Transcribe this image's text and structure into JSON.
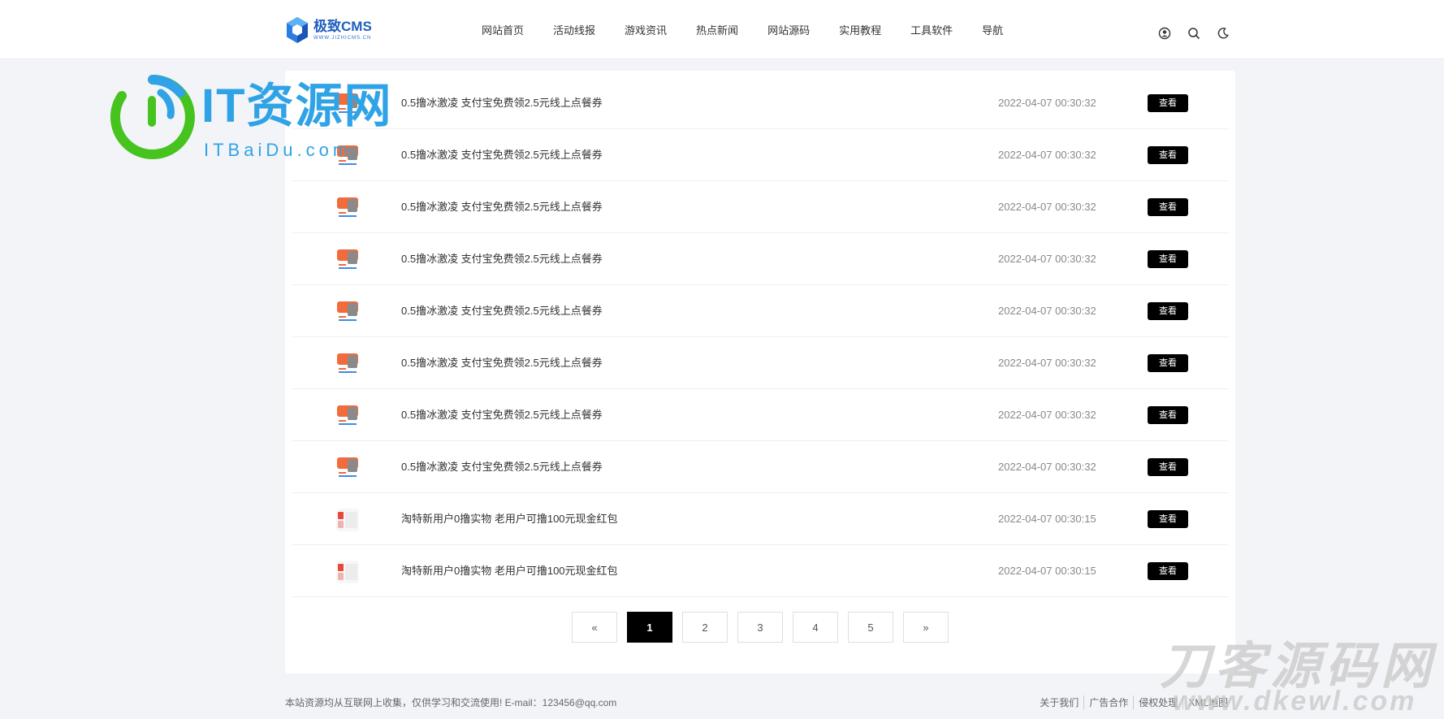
{
  "header": {
    "logo_name": "极致CMS",
    "logo_sub": "WWW.JIZHICMS.CN",
    "nav": [
      "网站首页",
      "活动线报",
      "游戏资讯",
      "热点新闻",
      "网站源码",
      "实用教程",
      "工具软件",
      "导航"
    ],
    "icons": [
      "user-icon",
      "search-icon",
      "moon-icon"
    ]
  },
  "list": {
    "button_label": "查看",
    "rows": [
      {
        "title": "0.5撸冰激凌 支付宝免费领2.5元线上点餐券",
        "date": "2022-04-07 00:30:32"
      },
      {
        "title": "0.5撸冰激凌 支付宝免费领2.5元线上点餐券",
        "date": "2022-04-07 00:30:32"
      },
      {
        "title": "0.5撸冰激凌 支付宝免费领2.5元线上点餐券",
        "date": "2022-04-07 00:30:32"
      },
      {
        "title": "0.5撸冰激凌 支付宝免费领2.5元线上点餐券",
        "date": "2022-04-07 00:30:32"
      },
      {
        "title": "0.5撸冰激凌 支付宝免费领2.5元线上点餐券",
        "date": "2022-04-07 00:30:32"
      },
      {
        "title": "0.5撸冰激凌 支付宝免费领2.5元线上点餐券",
        "date": "2022-04-07 00:30:32"
      },
      {
        "title": "0.5撸冰激凌 支付宝免费领2.5元线上点餐券",
        "date": "2022-04-07 00:30:32"
      },
      {
        "title": "0.5撸冰激凌 支付宝免费领2.5元线上点餐券",
        "date": "2022-04-07 00:30:32"
      },
      {
        "title": "淘特新用户0撸实物 老用户可撸100元现金红包",
        "date": "2022-04-07 00:30:15"
      },
      {
        "title": "淘特新用户0撸实物 老用户可撸100元现金红包",
        "date": "2022-04-07 00:30:15"
      }
    ]
  },
  "pagination": {
    "prev": "«",
    "pages": [
      "1",
      "2",
      "3",
      "4",
      "5"
    ],
    "current": "1",
    "next": "»"
  },
  "footer": {
    "copyright": "本站资源均从互联网上收集，仅供学习和交流使用! E-mail：123456@qq.com",
    "links": [
      "关于我们",
      "广告合作",
      "侵权处理",
      "XML地图"
    ]
  },
  "watermarks": {
    "top_left_title": "IT资源网",
    "top_left_sub": "ITBaiDu.com",
    "bottom_right_title": "刀客源码网",
    "bottom_right_sub": "www.dkewl.com"
  },
  "colors": {
    "accent": "#000000",
    "logo_blue": "#1f5fbf",
    "watermark_blue": "#2fa3e6",
    "watermark_green": "#46c31f"
  }
}
